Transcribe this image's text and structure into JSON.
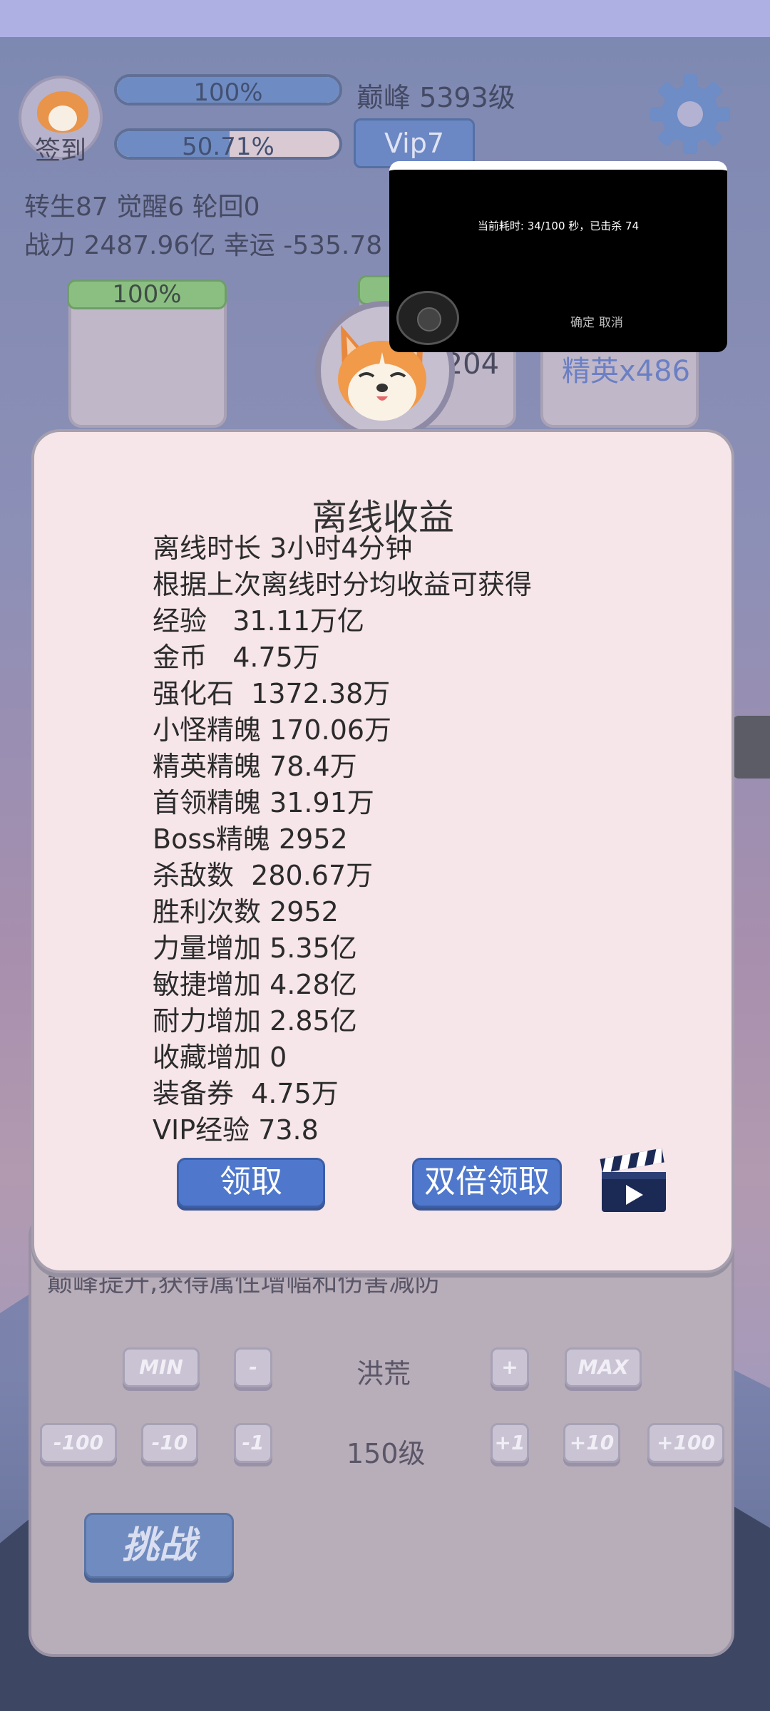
{
  "top": {
    "signin_label": "签到",
    "hp_bar": {
      "label": "100%",
      "fraction": 1.0
    },
    "exp_bar": {
      "label": "50.71%",
      "fraction": 0.5071
    },
    "peak_level": "巅峰 5393级",
    "vip_label": "Vip7",
    "stats_line1": "转生87 觉醒6 轮回0",
    "stats_line2": "战力 2487.96亿  幸运 -535.78"
  },
  "slots": {
    "left_bar": {
      "label": "100%",
      "fraction": 1.0
    },
    "middle_text": "x204",
    "right_text": "精英x486"
  },
  "video_overlay": {
    "timer_text": "当前耗时: 34/100 秒，已击杀 74",
    "confirm_label": "确定",
    "cancel_label": "取消"
  },
  "popup": {
    "title": "离线收益",
    "rows": [
      "离线时长 3小时4分钟",
      "根据上次离线时分均收益可获得",
      "经验   31.11万亿",
      "金币   4.75万",
      "强化石  1372.38万",
      "小怪精魄 170.06万",
      "精英精魄 78.4万",
      "首领精魄 31.91万",
      "Boss精魄 2952",
      "杀敌数  280.67万",
      "胜利次数 2952",
      "力量增加 5.35亿",
      "敏捷增加 4.28亿",
      "耐力增加 2.85亿",
      "收藏增加 0",
      "装备券  4.75万",
      "VIP经验 73.8"
    ],
    "claim_label": "领取",
    "double_claim_label": "双倍领取"
  },
  "lower": {
    "description": "巅峰提升,获得属性增幅和伤害减防",
    "min_label": "MIN",
    "minus_label": "-",
    "difficulty_name": "洪荒",
    "plus_label": "+",
    "max_label": "MAX",
    "minus100_label": "-100",
    "minus10_label": "-10",
    "minus1_label": "-1",
    "level_label": "150级",
    "plus1_label": "+1",
    "plus10_label": "+10",
    "plus100_label": "+100",
    "challenge_label": "挑战"
  },
  "colors": {
    "popup_bg": "#f6e5e9",
    "button_blue": "#4f78cd",
    "status_bar": "#aeb0e4"
  },
  "icons": [
    "avatar-dog-icon",
    "gear-icon",
    "dog-mascot-icon",
    "joystick-icon",
    "clapperboard-play-icon"
  ]
}
